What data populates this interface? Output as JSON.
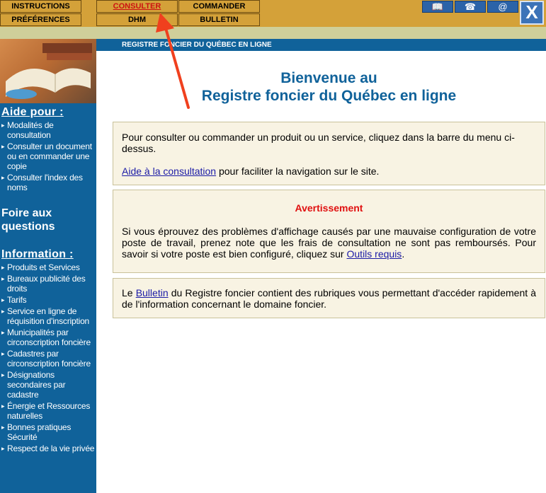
{
  "menu": {
    "items": [
      {
        "label": "INSTRUCTIONS"
      },
      {
        "label": "CONSULTER"
      },
      {
        "label": "COMMANDER"
      },
      {
        "label": "PRÉFÉRENCES"
      },
      {
        "label": "DHM"
      },
      {
        "label": "BULLETIN"
      }
    ],
    "icons": [
      {
        "name": "book-icon",
        "glyph": "📖"
      },
      {
        "name": "phone-icon",
        "glyph": "☎"
      },
      {
        "name": "email-icon",
        "glyph": "@"
      }
    ],
    "close_glyph": "X"
  },
  "header": {
    "banner": "REGISTRE FONCIER DU QUÉBEC EN LIGNE"
  },
  "welcome": {
    "line1": "Bienvenue au",
    "line2": "Registre foncier du Québec en ligne"
  },
  "sidebar": {
    "aide_title": "Aide pour :",
    "aide_items": [
      "Modalités de consultation",
      "Consulter un document ou en commander une copie",
      "Consulter l'index des noms"
    ],
    "faq": "Foire aux questions",
    "info_title": "Information :",
    "info_items": [
      "Produits et Services",
      "Bureaux publicité des droits",
      "Tarifs",
      "Service en ligne de réquisition d'inscription",
      "Municipalités par circonscription foncière",
      "Cadastres par circonscription foncière",
      "Désignations secondaires par cadastre",
      "Énergie et Ressources naturelles",
      "Bonnes pratiques Sécurité",
      "Respect de la vie privée"
    ]
  },
  "box1": {
    "text": "Pour consulter ou commander un produit ou un service, cliquez dans la barre du menu ci-dessus.",
    "link": "Aide à la consultation",
    "after": " pour faciliter la navigation sur le site."
  },
  "box2": {
    "title": "Avertissement",
    "text": "Si vous éprouvez des problèmes d'affichage causés par une mauvaise configuration de votre poste de travail, prenez note que les frais de consultation ne sont pas remboursés. Pour savoir si votre poste est bien configuré, cliquez sur ",
    "link": "Outils requis",
    "after": "."
  },
  "box3": {
    "before": "Le ",
    "link": "Bulletin",
    "after": " du Registre foncier contient des rubriques vous permettant d'accéder rapidement à de l'information concernant le domaine foncier."
  },
  "colors": {
    "menu_bg": "#d4a139",
    "sidebar_bg": "#10629a",
    "warning_red": "#e01010",
    "arrow_red": "#f0401e"
  }
}
